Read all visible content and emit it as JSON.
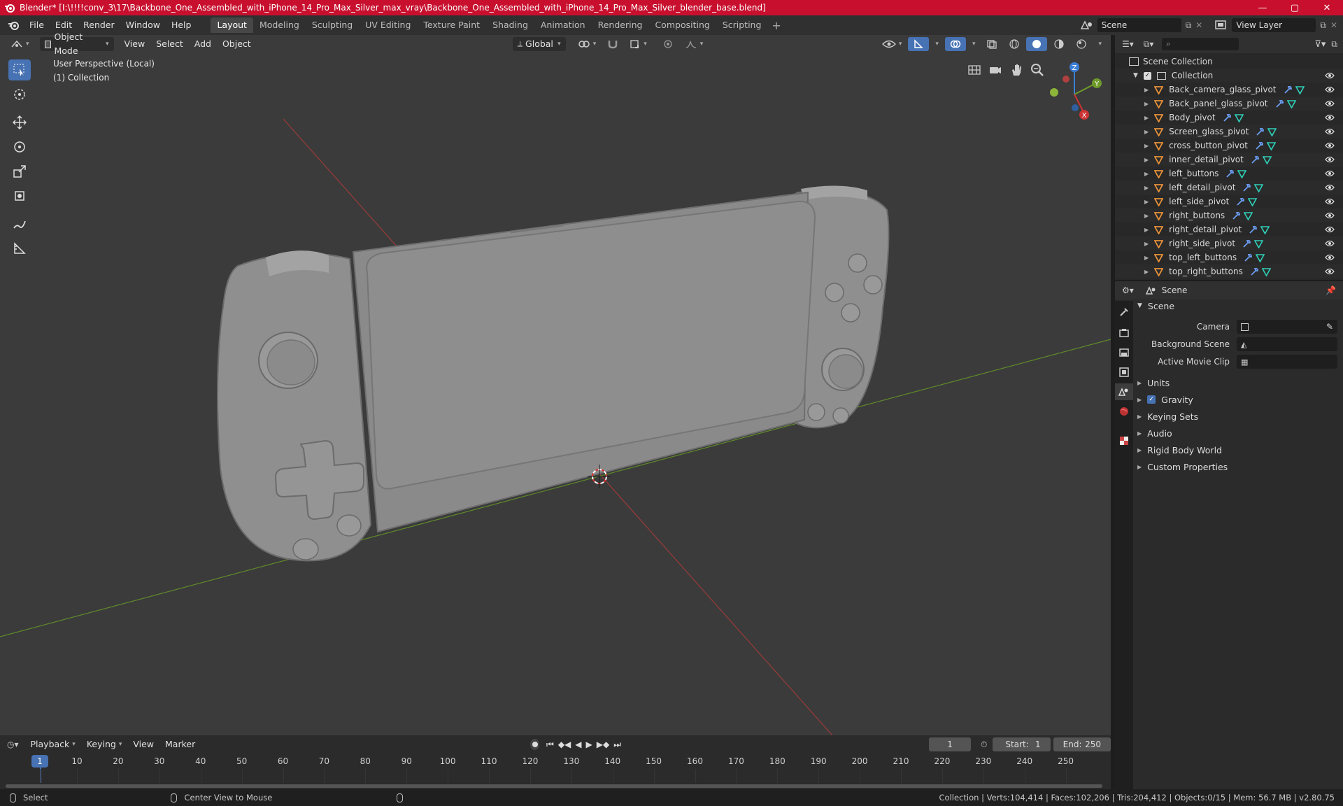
{
  "window": {
    "title": "Blender* [I:\\!!!!conv_3\\17\\Backbone_One_Assembled_with_iPhone_14_Pro_Max_Silver_max_vray\\Backbone_One_Assembled_with_iPhone_14_Pro_Max_Silver_blender_base.blend]",
    "minimize": "—",
    "maximize": "▢",
    "close": "✕"
  },
  "menu": {
    "file": "File",
    "edit": "Edit",
    "render": "Render",
    "window": "Window",
    "help": "Help"
  },
  "workspaces": [
    {
      "label": "Layout",
      "active": true
    },
    {
      "label": "Modeling"
    },
    {
      "label": "Sculpting"
    },
    {
      "label": "UV Editing"
    },
    {
      "label": "Texture Paint"
    },
    {
      "label": "Shading"
    },
    {
      "label": "Animation"
    },
    {
      "label": "Rendering"
    },
    {
      "label": "Compositing"
    },
    {
      "label": "Scripting"
    }
  ],
  "scene_field": "Scene",
  "view_layer_field": "View Layer",
  "viewport_header": {
    "mode": "Object Mode",
    "view": "View",
    "select": "Select",
    "add": "Add",
    "object": "Object",
    "orientation": "Global"
  },
  "viewport_overlay": {
    "perspective": "User Perspective (Local)",
    "collection": "(1) Collection"
  },
  "gizmo": {
    "z": "Z",
    "y": "Y",
    "x": "X"
  },
  "outliner": {
    "root": "Scene Collection",
    "collection": "Collection",
    "items": [
      "Back_camera_glass_pivot",
      "Back_panel_glass_pivot",
      "Body_pivot",
      "Screen_glass_pivot",
      "cross_button_pivot",
      "inner_detail_pivot",
      "left_buttons",
      "left_detail_pivot",
      "left_side_pivot",
      "right_buttons",
      "right_detail_pivot",
      "right_side_pivot",
      "top_left_buttons",
      "top_right_buttons"
    ]
  },
  "properties": {
    "header": "Scene",
    "panel": "Scene",
    "camera_label": "Camera",
    "background_scene_label": "Background Scene",
    "active_movie_clip_label": "Active Movie Clip",
    "sections": [
      "Units",
      "Gravity",
      "Keying Sets",
      "Audio",
      "Rigid Body World",
      "Custom Properties"
    ]
  },
  "timeline": {
    "playback": "Playback",
    "keying": "Keying",
    "view": "View",
    "marker": "Marker",
    "current_frame": "1",
    "start_label": "Start:",
    "start": "1",
    "end_label": "End:",
    "end": "250",
    "ticks": [
      "1",
      "10",
      "20",
      "30",
      "40",
      "50",
      "60",
      "70",
      "80",
      "90",
      "100",
      "110",
      "120",
      "130",
      "140",
      "150",
      "160",
      "170",
      "180",
      "190",
      "200",
      "210",
      "220",
      "230",
      "240",
      "250"
    ]
  },
  "status": {
    "select": "Select",
    "center_view": "Center View to Mouse",
    "stats": "Collection | Verts:104,414 | Faces:102,206 | Tris:204,412 | Objects:0/15 | Mem: 56.7 MB | v2.80.75"
  },
  "colors": {
    "titlebar": "#c8102e",
    "accent": "#4772b3",
    "viewport_bg": "#3b3b3b",
    "x_axis": "#b93a3a",
    "y_axis": "#6f9a2a",
    "object_icon": "#e8923a",
    "modifier_icon": "#6b9cf0",
    "mesh_icon": "#2fd0b8"
  }
}
